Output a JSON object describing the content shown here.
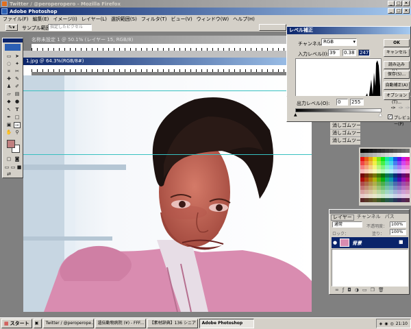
{
  "firefox_title": "Twitter / @peroperopero - Mozilla Firefox",
  "ps_title": "Adobe Photoshop",
  "menu": [
    "ファイル(F)",
    "編集(E)",
    "イメージ(I)",
    "レイヤー(L)",
    "選択範囲(S)",
    "フィルタ(T)",
    "ビュー(V)",
    "ウィンドウ(W)",
    "ヘルプ(H)"
  ],
  "options": {
    "sample_label": "サンプル範囲：",
    "sample_value": "指定したピクセル"
  },
  "doc1_title": "名称未設定 1 ＠ 50.1% (レイヤー 15, RGB/8)",
  "doc2_title": "1.jpg ＠ 64.3%(RGB/8#)",
  "levels": {
    "title": "レベル補正",
    "channel_label": "チャンネル(C):",
    "channel_value": "RGB",
    "input_label": "入力レベル(I):",
    "input_black": "39",
    "input_gamma": "0.38",
    "input_white": "247",
    "output_label": "出力レベル(O):",
    "output_black": "0",
    "output_white": "255",
    "ok": "OK",
    "cancel": "キャンセル",
    "load": "読み込み(L)...",
    "save": "保存(S)...",
    "auto": "自動補正(A)",
    "options": "オプション(T)...",
    "preview": "プレビュー(P)"
  },
  "history": [
    "消しゴムツール",
    "消しゴムツール",
    "消しゴムツール"
  ],
  "layers": {
    "tab1": "レイヤー",
    "tab2": "チャンネル",
    "tab3": "パス",
    "blend": "通常",
    "opacity_label": "不透明度：",
    "opacity": "100%",
    "lock_label": "ロック：",
    "fill_label": "塗り：",
    "fill": "100%",
    "layer_name": "背景"
  },
  "taskbar": {
    "start": "スタート",
    "tasks": [
      "Twitter / @peroperope...",
      "遺伝動物病院 (¥) - FFF...",
      "【素材辞典】136 シニア・ロ...",
      "Adobe Photoshop"
    ],
    "clock": "21:10"
  },
  "colors": {
    "title_active": "#0a246a",
    "guide": "#37c0c0",
    "fg_swatch": "#c08080",
    "bg_swatch": "#ffffff"
  }
}
